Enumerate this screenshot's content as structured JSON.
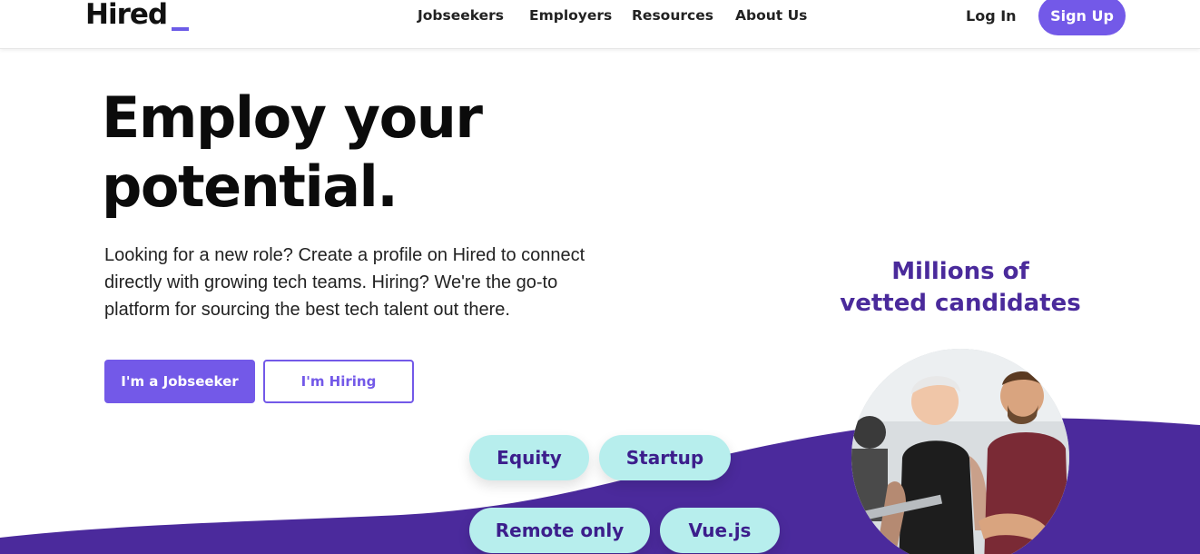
{
  "header": {
    "logo": "Hired",
    "nav": [
      "Jobseekers",
      "Employers",
      "Resources",
      "About Us"
    ],
    "login_label": "Log In",
    "signup_label": "Sign Up"
  },
  "hero": {
    "title_line1": "Employ your",
    "title_line2": "potential.",
    "description": "Looking for a new role? Create a profile on Hired to connect directly with growing tech teams. Hiring? We're the go-to platform for sourcing the best tech talent out there.",
    "jobseeker_button": "I'm a Jobseeker",
    "hiring_button": "I'm Hiring"
  },
  "side": {
    "title_line1": "Millions of",
    "title_line2": "vetted candidates"
  },
  "pills": [
    "Equity",
    "Startup",
    "Remote only",
    "Vue.js"
  ],
  "colors": {
    "accent": "#7359e8",
    "wave": "#4b2a9c",
    "pill_bg": "#b7eeed",
    "pill_text": "#3c1e8c"
  }
}
